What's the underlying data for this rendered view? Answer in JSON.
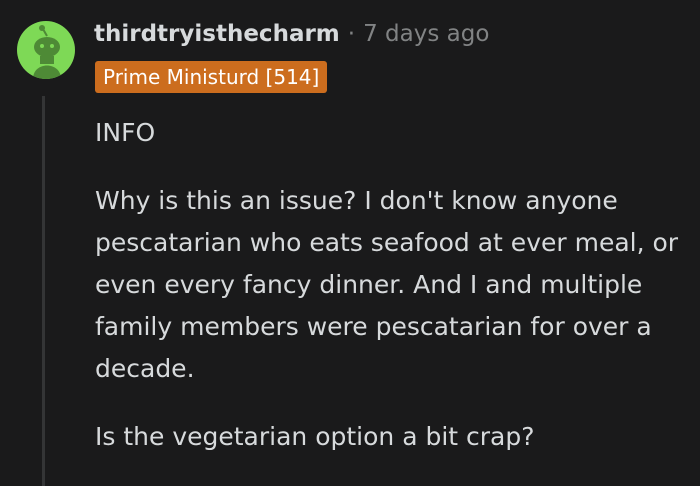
{
  "comment": {
    "username": "thirdtryisthecharm",
    "separator": "·",
    "timestamp": "7 days ago",
    "flair": "Prime Ministurd [514]",
    "paragraphs": [
      "INFO",
      "Why is this an issue? I don't know anyone pescatarian who eats seafood at ever meal, or even every fancy dinner. And I and multiple family members were pescatarian for over a decade.",
      "Is the vegetarian option a bit crap?"
    ]
  },
  "colors": {
    "background": "#1a1a1b",
    "text": "#d7dadc",
    "muted": "#818384",
    "flair_bg": "#cc6d1e",
    "avatar_bg": "#7ed956",
    "snoo_body": "#5a8f3c"
  },
  "icons": {
    "avatar": "snoo-avatar-icon"
  }
}
